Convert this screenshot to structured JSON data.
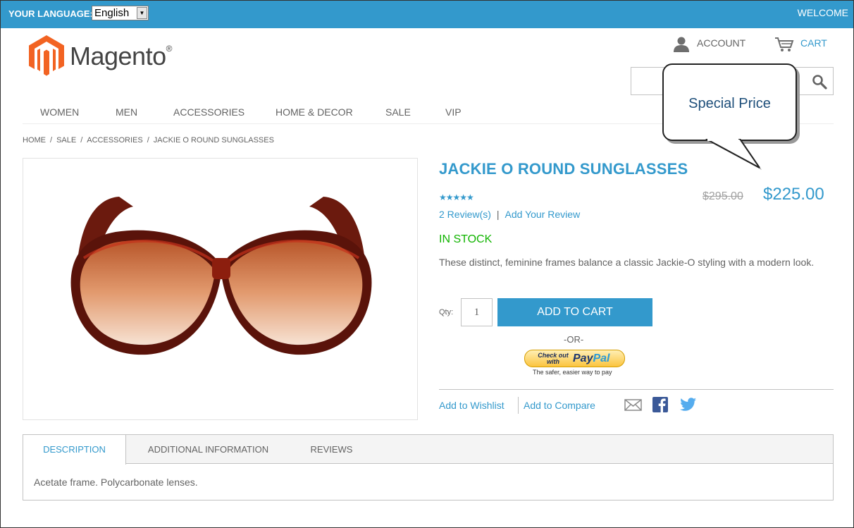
{
  "topbar": {
    "language_label": "YOUR LANGUAGE:",
    "language_value": "English",
    "welcome": "WELCOME",
    "bg_color": "#3399cc"
  },
  "header": {
    "logo_text": "Magento",
    "logo_mark": "®",
    "account_label": "ACCOUNT",
    "cart_label": "CART",
    "search_placeholder": ""
  },
  "nav": {
    "items": [
      "WOMEN",
      "MEN",
      "ACCESSORIES",
      "HOME & DECOR",
      "SALE",
      "VIP"
    ]
  },
  "breadcrumb": [
    "HOME",
    "SALE",
    "ACCESSORIES",
    "JACKIE O ROUND SUNGLASSES"
  ],
  "callout": {
    "text": "Special Price"
  },
  "product": {
    "title": "JACKIE O ROUND SUNGLASSES",
    "rating_stars": 5,
    "stars_glyph": "★★★★★",
    "reviews_link": "2 Review(s)",
    "add_review_link": "Add Your Review",
    "old_price": "$295.00",
    "price": "$225.00",
    "stock": "IN STOCK",
    "description": "These distinct, feminine frames balance a classic Jackie-O styling with a modern look.",
    "qty_label": "Qty:",
    "qty_value": "1",
    "add_to_cart": "ADD TO CART",
    "or_text": "-OR-",
    "paypal": {
      "check_out": "Check out with",
      "logo_pay": "Pay",
      "logo_pal": "Pal",
      "tagline": "The safer, easier way to pay"
    },
    "wishlist": "Add to Wishlist",
    "compare": "Add to Compare",
    "share_icons": [
      "email-icon",
      "facebook-icon",
      "twitter-icon"
    ]
  },
  "tabs": {
    "items": [
      "DESCRIPTION",
      "ADDITIONAL INFORMATION",
      "REVIEWS"
    ],
    "active": 0,
    "content": "Acetate frame. Polycarbonate lenses."
  },
  "colors": {
    "accent": "#3399cc",
    "stock": "#11b400",
    "logo_orange": "#f26322"
  }
}
